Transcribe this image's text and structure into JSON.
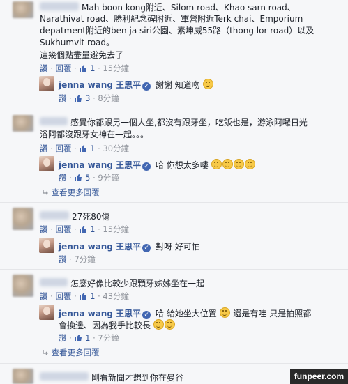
{
  "comments": [
    {
      "text_lines": [
        "Mah boon kong附近、Silom road、Khao sarn road、",
        "Narathivat road、勝利紀念碑附近、軍營附近Terk chai、Emporium",
        "depatment附近的ben ja siri公園、素坤威55路（thong lor road）以及",
        "Sukhumvit road。",
        "這幾個點盡量避免去了"
      ],
      "like_label": "讚",
      "reply_label": "回覆",
      "likes": "1",
      "time": "15分鐘"
    },
    {
      "text_lines": [
        "感覺你都跟另一個人坐,都沒有跟牙坐，吃飯也是，游泳阿囉日光",
        "浴阿都沒跟牙女神在一起。。。"
      ],
      "like_label": "讚",
      "reply_label": "回覆",
      "likes": "1",
      "time": "30分鐘"
    },
    {
      "text_lines": [
        "27死80傷"
      ],
      "like_label": "讚",
      "reply_label": "回覆",
      "likes": "1",
      "time": "15分鐘"
    },
    {
      "text_lines": [
        "怎麼好像比較少跟顆牙姊姊坐在一起"
      ],
      "like_label": "讚",
      "reply_label": "回覆",
      "likes": "1",
      "time": "43分鐘"
    },
    {
      "text_lines": [
        "剛看新聞才想到你在曼谷"
      ]
    }
  ],
  "replies": [
    {
      "author": "jenna wang 王思平",
      "text": "謝謝 知道吻",
      "like_label": "讚",
      "likes": "3",
      "time": "8分鐘"
    },
    {
      "author": "jenna wang 王思平",
      "text": "哈 你想太多嘍",
      "like_label": "讚",
      "likes": "5",
      "time": "9分鐘"
    },
    {
      "author": "jenna wang 王思平",
      "text": "對呀 好可怕",
      "like_label": "讚",
      "time": "7分鐘"
    },
    {
      "author": "jenna wang 王思平",
      "text_line1a": "哈 給她坐大位置",
      "text_line1b": "還是有哇 只是拍照都",
      "text_line2": "會換邊、因為我手比較長",
      "like_label": "讚",
      "likes": "1",
      "time": "7分鐘"
    }
  ],
  "more_replies": "查看更多回覆",
  "verified_glyph": "✓",
  "watermark": "funpeer.com"
}
